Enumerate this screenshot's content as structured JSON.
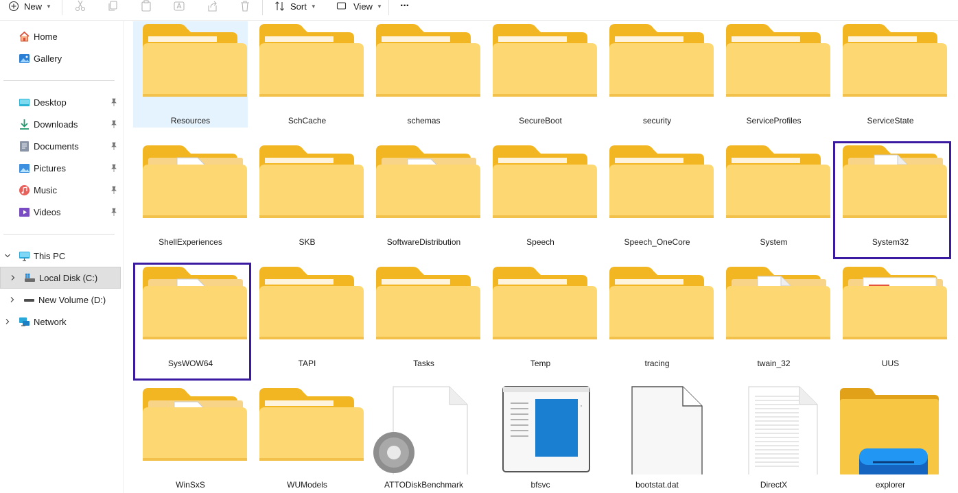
{
  "toolbar": {
    "new_label": "New",
    "sort_label": "Sort",
    "view_label": "View",
    "more_label": "···"
  },
  "sidebar": {
    "items": [
      {
        "label": "Home",
        "icon": "home-icon"
      },
      {
        "label": "Gallery",
        "icon": "gallery-icon"
      },
      {
        "label": "Desktop",
        "icon": "desktop-icon",
        "pinned": true
      },
      {
        "label": "Downloads",
        "icon": "downloads-icon",
        "pinned": true
      },
      {
        "label": "Documents",
        "icon": "documents-icon",
        "pinned": true
      },
      {
        "label": "Pictures",
        "icon": "pictures-icon",
        "pinned": true
      },
      {
        "label": "Music",
        "icon": "music-icon",
        "pinned": true
      },
      {
        "label": "Videos",
        "icon": "videos-icon",
        "pinned": true
      },
      {
        "label": "This PC",
        "icon": "this-pc-icon",
        "expanded": true
      },
      {
        "label": "Local Disk (C:)",
        "icon": "local-disk-icon",
        "selected": true
      },
      {
        "label": "New Volume (D:)",
        "icon": "drive-icon"
      },
      {
        "label": "Network",
        "icon": "network-icon"
      }
    ]
  },
  "files": [
    {
      "name": "Resources",
      "type": "folder"
    },
    {
      "name": "SchCache",
      "type": "folder"
    },
    {
      "name": "schemas",
      "type": "folder"
    },
    {
      "name": "SecureBoot",
      "type": "folder"
    },
    {
      "name": "security",
      "type": "folder"
    },
    {
      "name": "ServiceProfiles",
      "type": "folder"
    },
    {
      "name": "ServiceState",
      "type": "folder"
    },
    {
      "name": "ShellExperiences",
      "type": "folder-gear"
    },
    {
      "name": "SKB",
      "type": "folder"
    },
    {
      "name": "SoftwareDistribution",
      "type": "folder-doc"
    },
    {
      "name": "Speech",
      "type": "folder"
    },
    {
      "name": "Speech_OneCore",
      "type": "folder"
    },
    {
      "name": "System",
      "type": "folder"
    },
    {
      "name": "System32",
      "type": "folder-page"
    },
    {
      "name": "SysWOW64",
      "type": "folder-gear"
    },
    {
      "name": "TAPI",
      "type": "folder"
    },
    {
      "name": "Tasks",
      "type": "folder"
    },
    {
      "name": "Temp",
      "type": "folder"
    },
    {
      "name": "tracing",
      "type": "folder"
    },
    {
      "name": "twain_32",
      "type": "folder-page"
    },
    {
      "name": "UUS",
      "type": "folder-app"
    },
    {
      "name": "WinSxS",
      "type": "folder-doc"
    },
    {
      "name": "WUModels",
      "type": "folder"
    },
    {
      "name": "ATTODiskBenchmark",
      "type": "config-file"
    },
    {
      "name": "bfsvc",
      "type": "exe"
    },
    {
      "name": "bootstat.dat",
      "type": "blank-file"
    },
    {
      "name": "DirectX",
      "type": "text-file"
    },
    {
      "name": "explorer",
      "type": "explorer-exe"
    }
  ],
  "colors": {
    "folder_back": "#f3b623",
    "folder_front": "#fcd772",
    "selection_outline": "#3a1aa0",
    "hover_bg": "#e5f3ff",
    "nav_selected_bg": "#e0e0e0"
  }
}
